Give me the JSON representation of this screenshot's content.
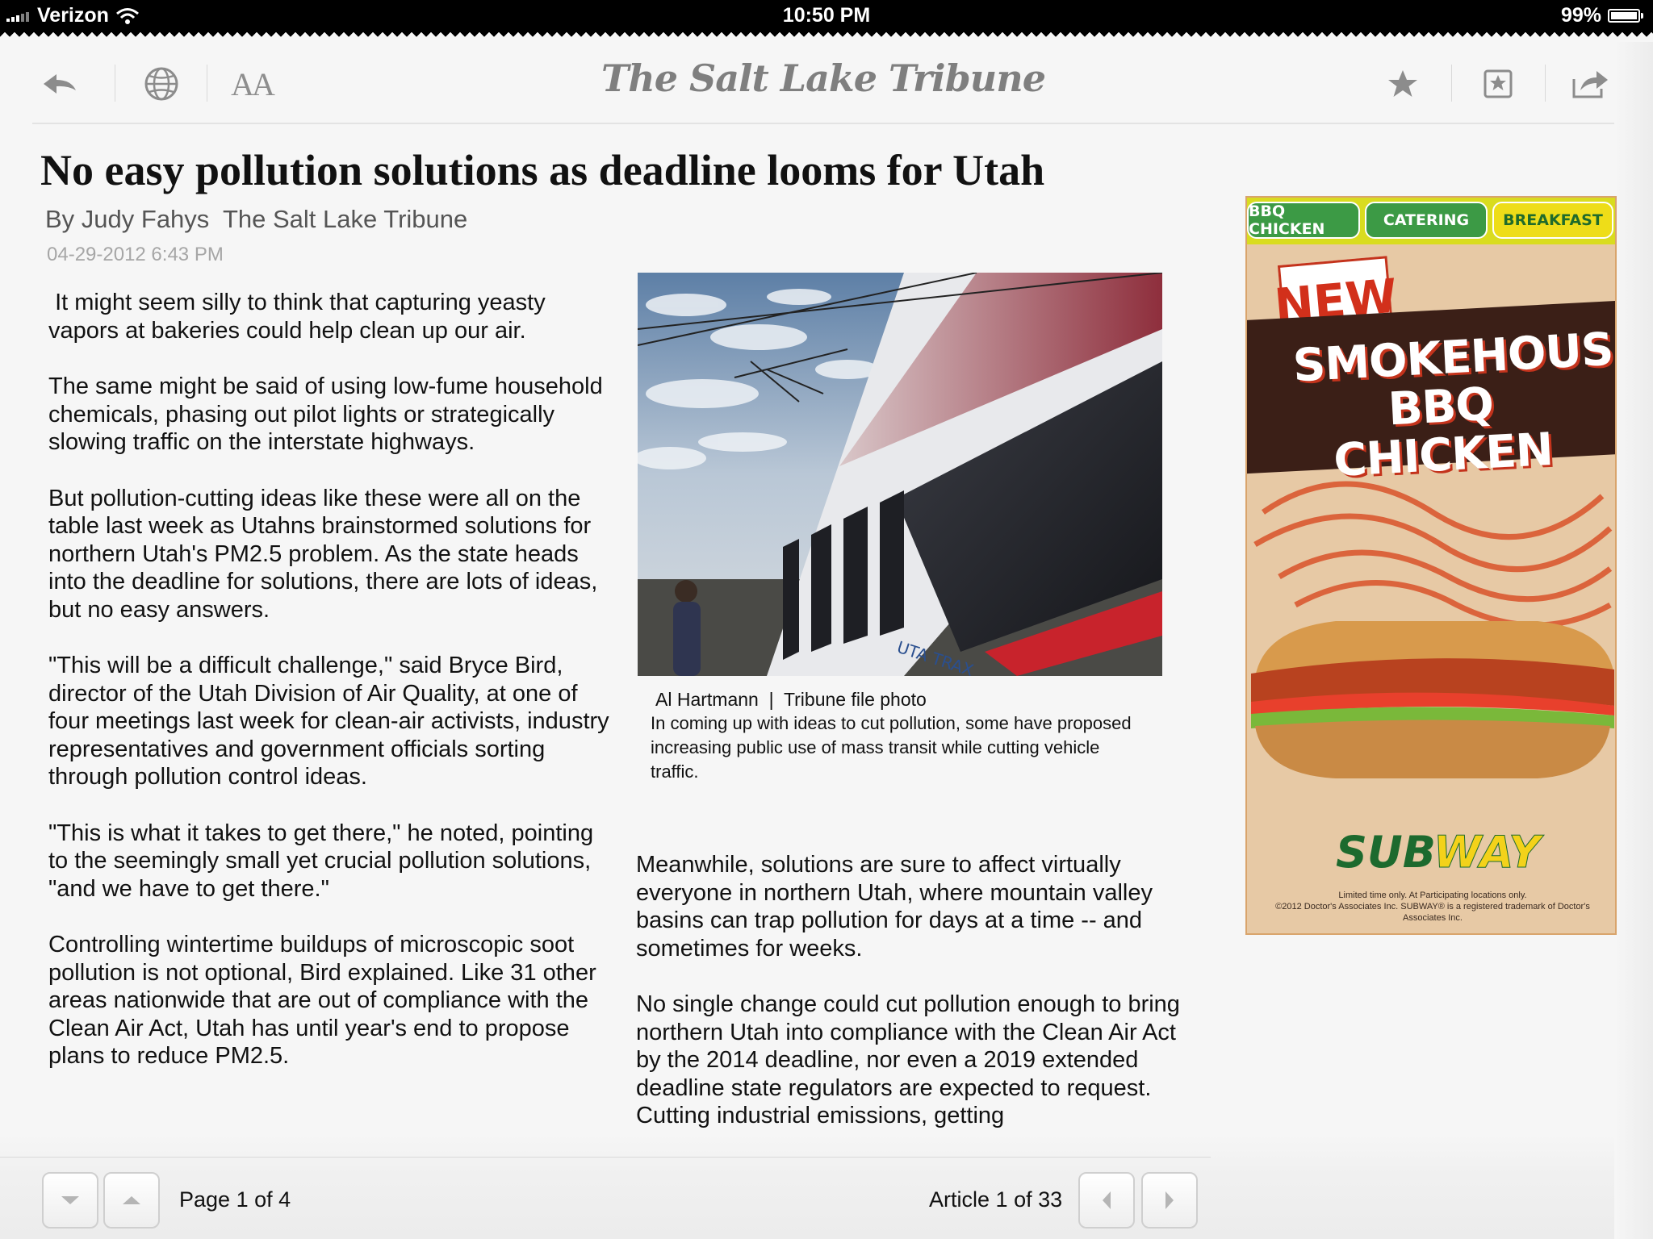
{
  "status_bar": {
    "carrier": "Verizon",
    "time": "10:50 PM",
    "battery_text": "99%",
    "battery_level": 0.99
  },
  "toolbar": {
    "masthead": "The Salt Lake Tribune",
    "font_size_label": "AA",
    "icons": [
      "back-arrow-icon",
      "globe-icon",
      "font-size-icon",
      "star-icon",
      "bookmark-star-icon",
      "share-icon"
    ]
  },
  "article": {
    "headline": "No easy pollution solutions as deadline looms for Utah",
    "byline": "By Judy Fahys  The Salt Lake Tribune",
    "date": "04-29-2012 6:43 PM",
    "left_paragraphs": [
      " It might seem silly to think that capturing yeasty vapors at bakeries could help clean up our air.",
      "The same might be said of using low-fume household chemicals, phasing out pilot lights or strategically slowing traffic on the interstate highways.",
      "But pollution-cutting ideas like these were all on the table last week as Utahns brainstormed solutions for northern Utah's PM2.5 problem. As the state heads into the deadline for solutions, there are lots of ideas, but no easy answers.",
      "\"This will be a difficult challenge,\" said Bryce Bird, director of the Utah Division of Air Quality, at one of four meetings last week for clean-air activists, industry representatives and government officials sorting through pollution control ideas.",
      "\"This is what it takes to get there,\" he noted, pointing to the seemingly small yet crucial pollution solutions, \"and we have to get there.\"",
      "Controlling wintertime buildups of microscopic soot pollution is not optional, Bird explained. Like 31 other areas nationwide that are out of compliance with the Clean Air Act, Utah has until year's end to propose plans to reduce PM2.5."
    ],
    "right_paragraphs": [
      "Meanwhile, solutions are sure to affect virtually everyone in northern Utah, where mountain valley basins can trap pollution for days at a time -- and sometimes for weeks.",
      "No single change could cut pollution enough to bring northern Utah into compliance with the Clean Air Act by the 2014 deadline, nor even a 2019 extended deadline state regulators are expected to request. Cutting industrial emissions, getting"
    ],
    "photo": {
      "credit": "Al Hartmann  |  Tribune file photo",
      "caption": "In coming up with ideas to cut pollution, some have proposed increasing public use of mass transit while cutting vehicle traffic.",
      "train_label": "UTA TRAX"
    }
  },
  "ad": {
    "tabs": [
      "BBQ CHICKEN",
      "CATERING",
      "BREAKFAST"
    ],
    "badge": "NEW",
    "title_line1": "SMOKEHOUSE",
    "title_line2": "BBQ CHICKEN",
    "logo_sub": "SUB",
    "logo_way": "WAY",
    "fine_print_1": "Limited time only. At Participating locations only.",
    "fine_print_2": "©2012 Doctor's Associates Inc. SUBWAY® is a registered trademark of Doctor's Associates Inc."
  },
  "footer": {
    "page_label": "Page",
    "page_current": "1",
    "page_of": "of",
    "page_total": "4",
    "article_label": "Article",
    "article_current": "1",
    "article_of": "of",
    "article_total": "33"
  }
}
